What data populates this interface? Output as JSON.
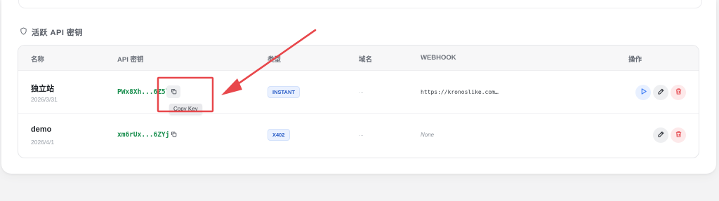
{
  "section": {
    "title": "活跃 API 密钥",
    "icon": "shield-icon"
  },
  "table": {
    "headers": {
      "name": "名称",
      "key": "API 密钥",
      "type": "类型",
      "domain": "域名",
      "webhook": "WEBHOOK",
      "actions": "操作"
    },
    "rows": [
      {
        "name": "独立站",
        "date": "2026/3/31",
        "key": "PWx8Xh...6Z5l",
        "type": "INSTANT",
        "domain": "...",
        "webhook": "https://kronoslike.com…",
        "actions": [
          "play-icon",
          "edit-icon",
          "trash-icon"
        ]
      },
      {
        "name": "demo",
        "date": "2026/4/1",
        "key": "xm6rUx...6ZYj",
        "type": "X402",
        "domain": "...",
        "webhook": "None",
        "actions": [
          "edit-icon",
          "trash-icon"
        ]
      }
    ]
  },
  "tooltip": {
    "text": "Copy Key"
  },
  "colors": {
    "accent_red": "#e8474b",
    "key_green": "#1a8f4f",
    "badge_blue": "#2b5ec7",
    "run_blue": "#3b7bf5",
    "delete_red": "#e5484d"
  }
}
